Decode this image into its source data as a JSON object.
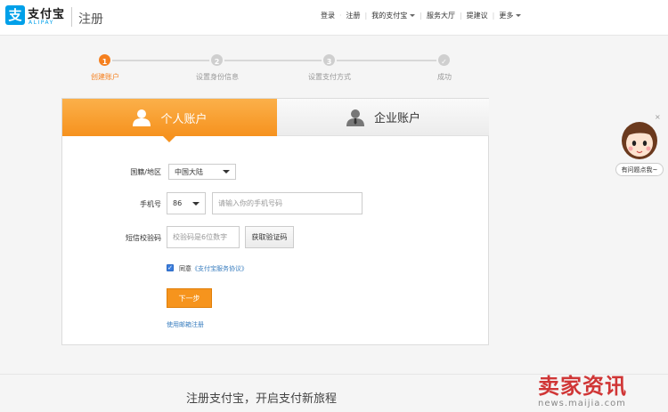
{
  "header": {
    "logo_mark": "支",
    "logo_text": "支付宝",
    "logo_sub": "ALIPAY",
    "title": "注册",
    "nav": [
      {
        "label": "登录",
        "dropdown": false
      },
      {
        "label": "注册",
        "dropdown": false
      },
      {
        "label": "我的支付宝",
        "dropdown": true
      },
      {
        "label": "服务大厅",
        "dropdown": false
      },
      {
        "label": "提建议",
        "dropdown": false
      },
      {
        "label": "更多",
        "dropdown": true
      }
    ]
  },
  "steps": [
    {
      "number": "1",
      "label": "创建账户",
      "active": true
    },
    {
      "number": "2",
      "label": "设置身份信息",
      "active": false
    },
    {
      "number": "3",
      "label": "设置支付方式",
      "active": false
    },
    {
      "number": "✓",
      "label": "成功",
      "active": false
    }
  ],
  "tabs": {
    "personal": "个人账户",
    "company": "企业账户"
  },
  "form": {
    "country_label": "国籍/地区",
    "country_value": "中国大陆",
    "phone_label": "手机号",
    "phone_code": "86",
    "phone_placeholder": "请输入你的手机号码",
    "sms_label": "短信校验码",
    "sms_placeholder": "校验码是6位数字",
    "get_code_button": "获取验证码",
    "agree_text": "同意",
    "agree_link": "《支付宝服务协议》",
    "agree_checked": true,
    "next_button": "下一步",
    "email_link": "使用邮箱注册"
  },
  "footer": {
    "slogan": "注册支付宝，开启支付新旅程"
  },
  "helper": {
    "button": "有问题点我~",
    "close": "×"
  },
  "watermark": {
    "cn": "卖家资讯",
    "en": "news.maijia.com"
  },
  "colors": {
    "accent": "#f6921e",
    "brand": "#00a0e9",
    "link": "#3a7ebf"
  }
}
